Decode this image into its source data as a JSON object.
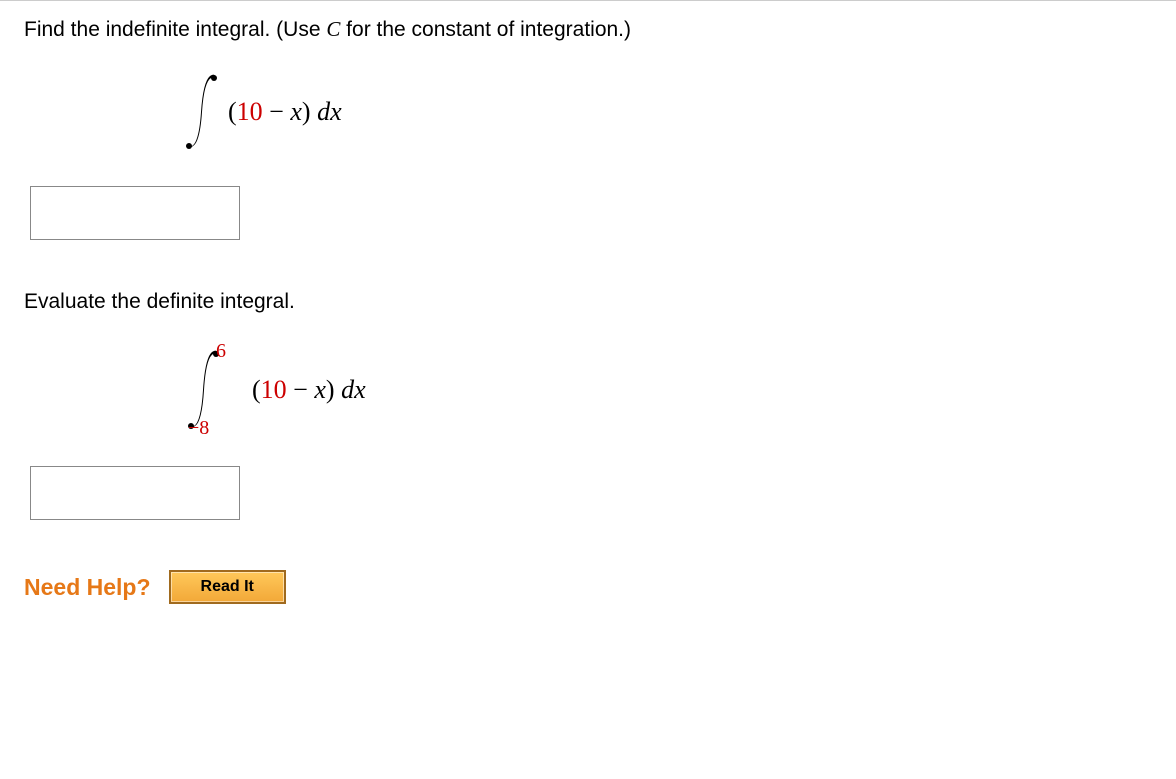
{
  "part1": {
    "prompt_pre": "Find the indefinite integral. (Use ",
    "prompt_C": "C",
    "prompt_post": " for the constant of integration.)",
    "integrand_open": "(",
    "integrand_num": "10",
    "integrand_minus": " − ",
    "integrand_x": "x",
    "integrand_close": ") ",
    "integrand_dx_d": "d",
    "integrand_dx_x": "x"
  },
  "part2": {
    "prompt": "Evaluate the definite integral.",
    "upper_limit": "6",
    "lower_limit": "−8",
    "integrand_open": "(",
    "integrand_num": "10",
    "integrand_minus": " − ",
    "integrand_x": "x",
    "integrand_close": ") ",
    "integrand_dx_d": "d",
    "integrand_dx_x": "x"
  },
  "help": {
    "label": "Need Help?",
    "read_it": "Read It"
  }
}
